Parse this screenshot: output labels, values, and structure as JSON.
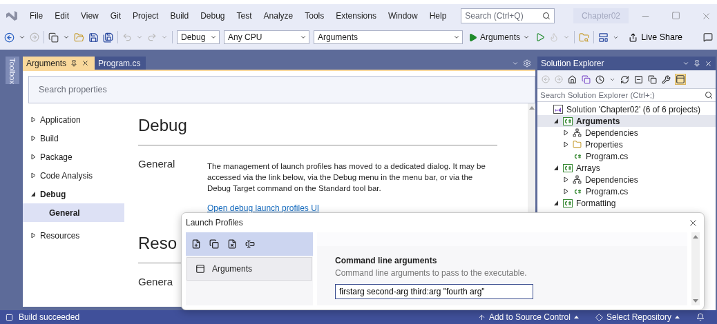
{
  "menu_bar": {
    "items": [
      "File",
      "Edit",
      "View",
      "Git",
      "Project",
      "Build",
      "Debug",
      "Test",
      "Analyze",
      "Tools",
      "Extensions",
      "Window",
      "Help"
    ],
    "search": {
      "placeholder": "Search (Ctrl+Q)"
    },
    "solution_badge": "Chapter02"
  },
  "toolbar": {
    "combos": [
      {
        "kind": "small",
        "value": "Debug"
      },
      {
        "kind": "medium",
        "value": "Any CPU"
      },
      {
        "kind": "wide",
        "value": "Arguments"
      }
    ],
    "run_target": "Arguments",
    "live_share": "Live Share"
  },
  "toolbox": {
    "label": "Toolbox"
  },
  "document_tabs": [
    {
      "label": "Arguments",
      "selected": true
    },
    {
      "label": "Program.cs",
      "selected": false
    }
  ],
  "properties": {
    "search": {
      "placeholder": "Search properties"
    },
    "nav": [
      {
        "label": "Application",
        "expanded": false,
        "selected": false
      },
      {
        "label": "Build",
        "expanded": false,
        "selected": false
      },
      {
        "label": "Package",
        "expanded": false,
        "selected": false
      },
      {
        "label": "Code Analysis",
        "expanded": false,
        "selected": false
      },
      {
        "label": "Debug",
        "expanded": true,
        "selected": false,
        "children": [
          {
            "label": "General",
            "selected": true
          }
        ]
      },
      {
        "label": "Resources",
        "expanded": false,
        "selected": false
      }
    ],
    "sections": [
      {
        "heading": "Debug",
        "groups": [
          {
            "title": "General",
            "text": "The management of launch profiles has moved to a dedicated dialog. It may be accessed via the link below, via the Debug menu in the menu bar, or via the Debug Target command on the Standard tool bar.",
            "link": "Open debug launch profiles UI"
          }
        ]
      },
      {
        "heading": "Reso",
        "groups": [
          {
            "title": "Genera"
          }
        ]
      }
    ]
  },
  "solution_explorer": {
    "title": "Solution Explorer",
    "search": {
      "placeholder": "Search Solution Explorer (Ctrl+;)"
    },
    "tree": [
      {
        "label": "Solution 'Chapter02' (6 of 6 projects)",
        "kind": "solution",
        "expandable": false,
        "selected": false,
        "children": [
          {
            "label": "Arguments",
            "kind": "project",
            "expandable": true,
            "expanded": true,
            "selected": true,
            "children": [
              {
                "label": "Dependencies",
                "kind": "dependencies",
                "expandable": true,
                "expanded": false,
                "selected": false
              },
              {
                "label": "Properties",
                "kind": "folder",
                "expandable": true,
                "expanded": false,
                "selected": false
              },
              {
                "label": "Program.cs",
                "kind": "file",
                "expandable": false,
                "selected": false
              }
            ]
          },
          {
            "label": "Arrays",
            "kind": "project",
            "expandable": true,
            "expanded": true,
            "selected": false,
            "children": [
              {
                "label": "Dependencies",
                "kind": "dependencies",
                "expandable": true,
                "expanded": false,
                "selected": false
              },
              {
                "label": "Program.cs",
                "kind": "file",
                "expandable": true,
                "expanded": false,
                "selected": false
              }
            ]
          },
          {
            "label": "Formatting",
            "kind": "project",
            "expandable": true,
            "expanded": true,
            "selected": false
          }
        ]
      }
    ]
  },
  "dialog": {
    "title": "Launch Profiles",
    "profiles": [
      {
        "name": "Arguments",
        "selected": true
      }
    ],
    "field": {
      "label": "Command line arguments",
      "description": "Command line arguments to pass to the executable.",
      "value": "firstarg second-arg third:arg \"fourth arg\""
    }
  },
  "status_bar": {
    "message": "Build succeeded",
    "items": [
      "Add to Source Control",
      "Select Repository"
    ]
  }
}
